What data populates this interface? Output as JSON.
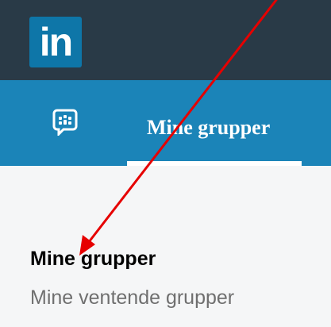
{
  "app": {
    "logo_text": "in",
    "brand_color": "#0e76a8",
    "header_color": "#293a47",
    "tabbar_color": "#1b84b8",
    "annotation_color": "#e60000"
  },
  "tabs": [
    {
      "label": "Mine grupper",
      "icon": "groups-chat-icon",
      "selected": true
    }
  ],
  "menu": {
    "items": [
      {
        "label": "Mine grupper",
        "active": true
      },
      {
        "label": "Mine ventende grupper",
        "active": false
      }
    ]
  },
  "annotation": {
    "type": "arrow",
    "icon": "red-arrow-icon"
  }
}
